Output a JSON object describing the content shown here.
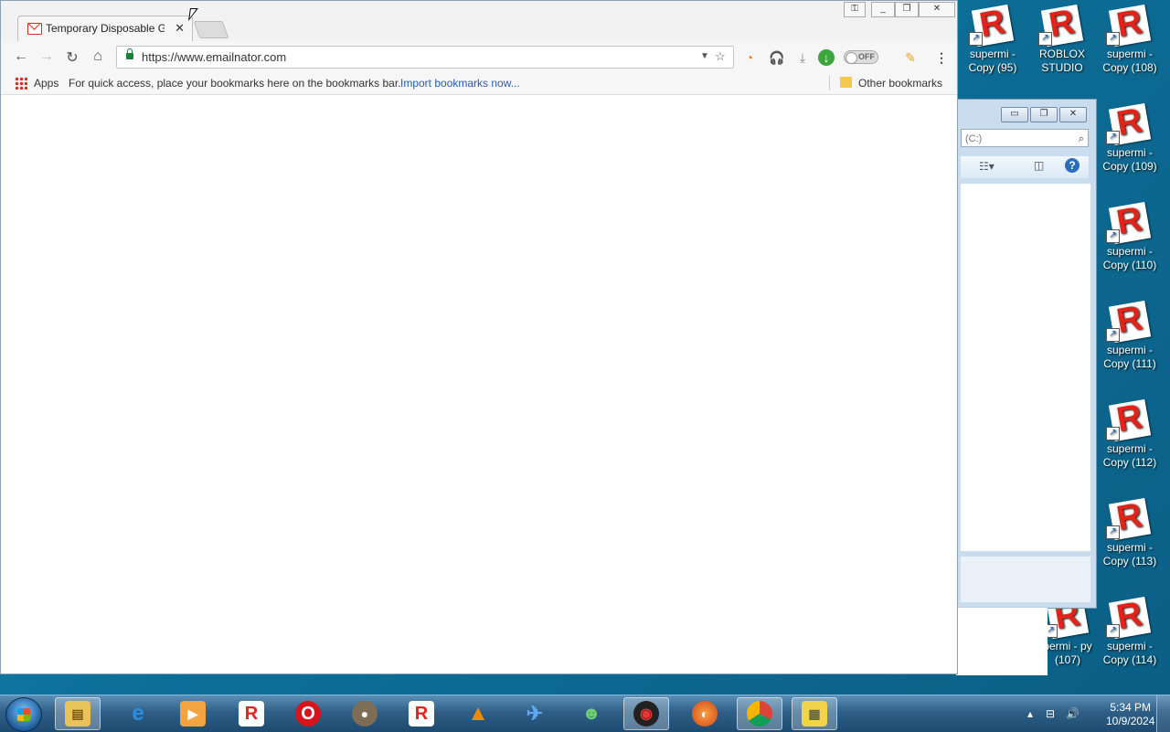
{
  "browser": {
    "tab_title": "Temporary Disposable G",
    "url": "https://www.emailnator.com",
    "extension_toggle": "OFF",
    "bookmarks_bar": {
      "apps_label": "Apps",
      "hint_text": "For quick access, place your bookmarks here on the bookmarks bar.",
      "import_link": "Import bookmarks now...",
      "other_bookmarks": "Other bookmarks"
    }
  },
  "explorer": {
    "address_fragment": "(C:)"
  },
  "desktop": {
    "icons": [
      {
        "label": "supermi - Copy (95)"
      },
      {
        "label": "ROBLOX STUDIO"
      },
      {
        "label": "supermi - Copy (108)"
      },
      {
        "label": "supermi - Copy (109)"
      },
      {
        "label": "supermi - Copy (110)"
      },
      {
        "label": "supermi - Copy (111)"
      },
      {
        "label": "supermi - Copy (112)"
      },
      {
        "label": "supermi - Copy (113)"
      },
      {
        "label": "permi - py (107)"
      },
      {
        "label": "supermi - Copy (114)"
      }
    ]
  },
  "taskbar": {
    "pinned": [
      "file-explorer-icon",
      "internet-explorer-icon",
      "media-player-icon",
      "roblox-icon",
      "opera-icon",
      "gimp-icon",
      "roblox-studio-icon",
      "vlc-icon",
      "bird-app-icon",
      "messenger-icon",
      "angry-bird-icon",
      "firefox-icon",
      "chrome-icon",
      "archive-icon"
    ],
    "clock_time": "5:34 PM",
    "clock_date": "10/9/2024"
  }
}
